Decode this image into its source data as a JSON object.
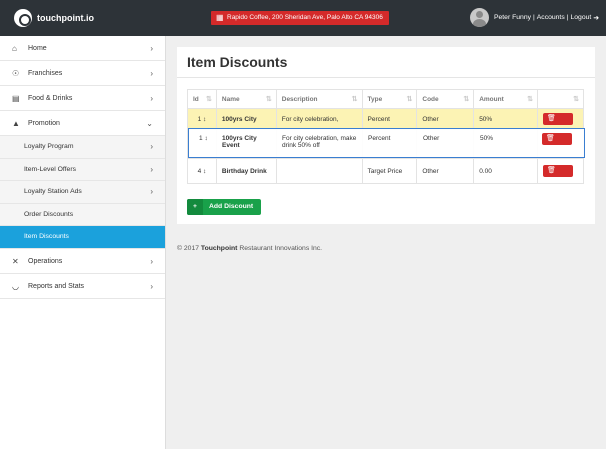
{
  "header": {
    "logo_text": "touchpoint.io",
    "location": "Rapido Coffee, 200 Sheridan Ave, Palo Alto CA 94306",
    "user_name": "Peter Funny",
    "separator": "|",
    "accounts_label": "Accounts",
    "logout_label": "Logout"
  },
  "sidebar": {
    "items": [
      {
        "label": "Home",
        "icon": "home-icon"
      },
      {
        "label": "Franchises",
        "icon": "globe-icon"
      },
      {
        "label": "Food & Drinks",
        "icon": "book-icon"
      },
      {
        "label": "Promotion",
        "icon": "megaphone-icon"
      }
    ],
    "promotion_sub": [
      {
        "label": "Loyalty Program"
      },
      {
        "label": "Item-Level Offers"
      },
      {
        "label": "Loyalty Station Ads"
      },
      {
        "label": "Order Discounts"
      },
      {
        "label": "Item Discounts"
      }
    ],
    "bottom_items": [
      {
        "label": "Operations",
        "icon": "tools-icon"
      },
      {
        "label": "Reports and Stats",
        "icon": "gauge-icon"
      }
    ]
  },
  "main": {
    "title": "Item Discounts",
    "columns": [
      "Id",
      "Name",
      "Description",
      "Type",
      "Code",
      "Amount",
      ""
    ],
    "rows": [
      {
        "id": "1",
        "name": "100yrs City",
        "description": "For city celebration,",
        "type": "Percent",
        "code": "Other",
        "amount": "50%"
      },
      {
        "id": "1",
        "name": "100yrs City Event",
        "description": "For city celebration, make drink 50% off",
        "type": "Percent",
        "code": "Other",
        "amount": "50%"
      },
      {
        "id": "4",
        "name": "Birthday Drink",
        "description": "",
        "type": "Target Price",
        "code": "Other",
        "amount": "0.00"
      }
    ],
    "add_button": "Add Discount",
    "footer_prefix": "© 2017",
    "footer_brand": "Touchpoint",
    "footer_suffix": "Restaurant Innovations Inc."
  },
  "colors": {
    "topbar": "#2d3338",
    "accent_red": "#d42a2a",
    "active_blue": "#1ba1dc",
    "add_green": "#19a14a",
    "drag_highlight": "#fcf3b4"
  }
}
